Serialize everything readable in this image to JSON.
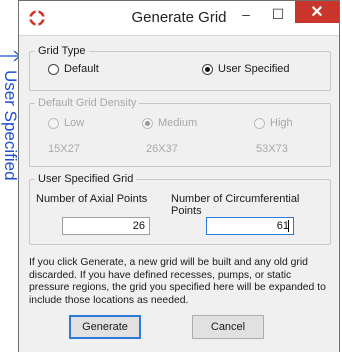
{
  "annotation": {
    "side_text": "User Specified"
  },
  "window": {
    "title": "Generate Grid",
    "controls": {
      "minimize": "–",
      "maximize": "☐",
      "close": "✕"
    }
  },
  "grid_type": {
    "legend": "Grid Type",
    "options": [
      {
        "label": "Default",
        "selected": false
      },
      {
        "label": "User Specified",
        "selected": true
      }
    ]
  },
  "default_density": {
    "legend": "Default Grid Density",
    "options": [
      {
        "label": "Low",
        "size": "15X27",
        "selected": false
      },
      {
        "label": "Medium",
        "size": "26X37",
        "selected": true
      },
      {
        "label": "High",
        "size": "53X73",
        "selected": false
      }
    ]
  },
  "user_grid": {
    "legend": "User Specified Grid",
    "axial_label": "Number of Axial Points",
    "axial_value": "26",
    "circ_label": "Number of Circumferential Points",
    "circ_value": "61"
  },
  "info_text": "If you click Generate, a new grid will be built and any old grid discarded. If you have defined recesses, pumps, or static pressure regions, the grid you specified here will be expanded to include those locations as needed.",
  "buttons": {
    "generate": "Generate",
    "cancel": "Cancel"
  },
  "colors": {
    "annotation": "#1f4fd1",
    "close_button": "#c9352a",
    "focus": "#2a7ad8"
  }
}
